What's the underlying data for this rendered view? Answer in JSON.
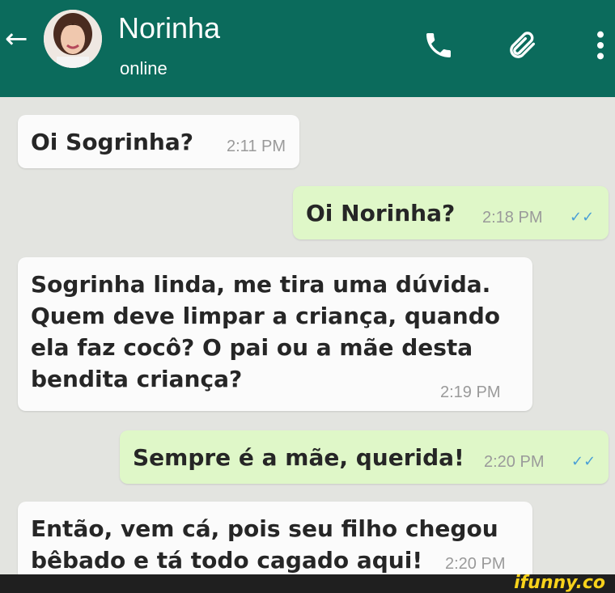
{
  "header": {
    "back_icon": "arrow-left-icon",
    "contact_name": "Norinha",
    "contact_status": "online",
    "icons": [
      "phone-icon",
      "paperclip-icon",
      "more-vertical-icon"
    ],
    "background": "#0b6b5c"
  },
  "messages": [
    {
      "direction": "incoming",
      "text": "Oi Sogrinha?",
      "time": "2:11 PM"
    },
    {
      "direction": "outgoing",
      "text": "Oi Norinha?",
      "time": "2:18 PM",
      "read": true
    },
    {
      "direction": "incoming",
      "lines": [
        "Sogrinha linda, me tira uma dúvida.",
        "Quem deve limpar a criança, quando",
        "ela faz cocô? O pai ou a mãe desta",
        "bendita criança?"
      ],
      "time": "2:19 PM"
    },
    {
      "direction": "outgoing",
      "text": "Sempre é a mãe, querida!",
      "time": "2:20 PM",
      "read": true
    },
    {
      "direction": "incoming",
      "lines": [
        "Então, vem cá, pois seu filho chegou",
        "bêbado e tá todo cagado aqui!"
      ],
      "time": "2:20 PM"
    }
  ],
  "tick_symbol": "✓✓",
  "footer": {
    "brand": "ifunny.co",
    "brand_color": "#f7d21b"
  }
}
